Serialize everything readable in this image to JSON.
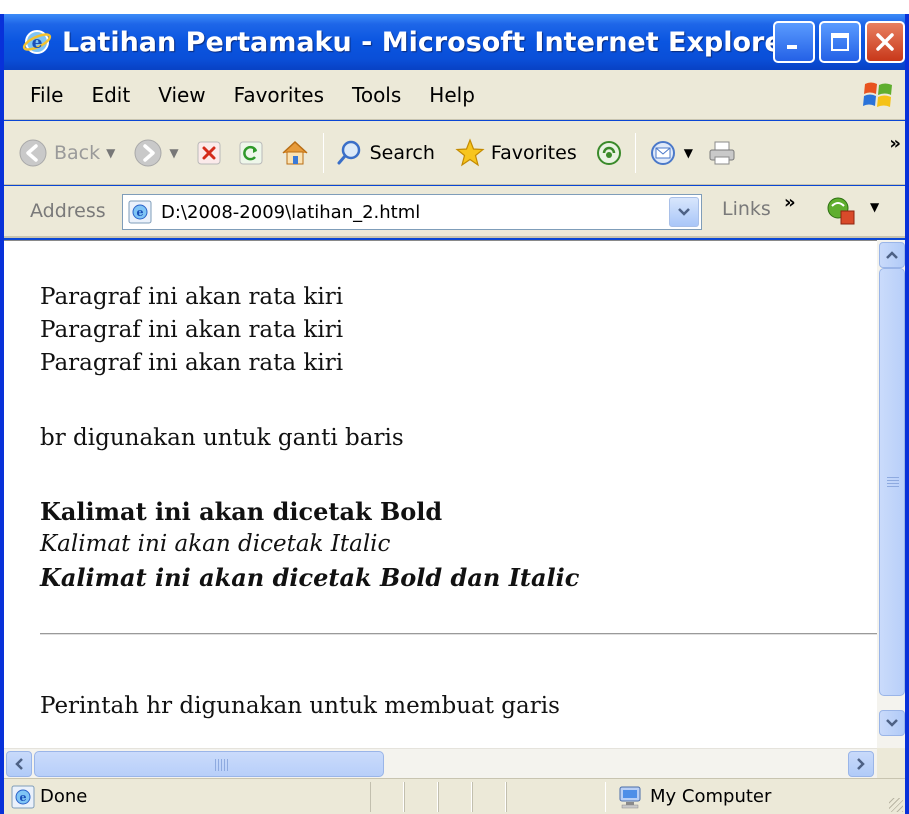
{
  "window": {
    "title": "Latihan Pertamaku - Microsoft Internet Explorer"
  },
  "menu": {
    "items": [
      "File",
      "Edit",
      "View",
      "Favorites",
      "Tools",
      "Help"
    ]
  },
  "toolbar": {
    "back_label": "Back",
    "search_label": "Search",
    "favorites_label": "Favorites",
    "overflow": "»"
  },
  "address": {
    "label": "Address",
    "value": "D:\\2008-2009\\latihan_2.html",
    "links_label": "Links",
    "links_overflow": "»"
  },
  "document": {
    "lines_left": [
      "Paragraf ini akan rata kiri",
      "Paragraf ini akan rata kiri",
      "Paragraf ini akan rata kiri"
    ],
    "br_text": "br digunakan untuk ganti baris",
    "bold_text": "Kalimat ini akan dicetak Bold",
    "italic_text": "Kalimat ini akan dicetak Italic",
    "bold_italic_text": "Kalimat ini akan dicetak Bold dan Italic",
    "hr_text": "Perintah hr digunakan untuk membuat garis"
  },
  "status": {
    "text": "Done",
    "zone": "My Computer"
  },
  "icons": {
    "title": "ie-icon",
    "back": "back-arrow-icon",
    "forward": "forward-arrow-icon",
    "stop": "stop-icon",
    "refresh": "refresh-icon",
    "home": "home-icon",
    "search": "search-icon",
    "favorites": "star-icon",
    "media": "media-icon",
    "mail": "mail-icon",
    "print": "print-icon"
  },
  "colors": {
    "titlebar": "#0a55e0",
    "chrome": "#ece9d8",
    "close_button": "#c8381a",
    "scrollbar": "#b8cff9"
  }
}
